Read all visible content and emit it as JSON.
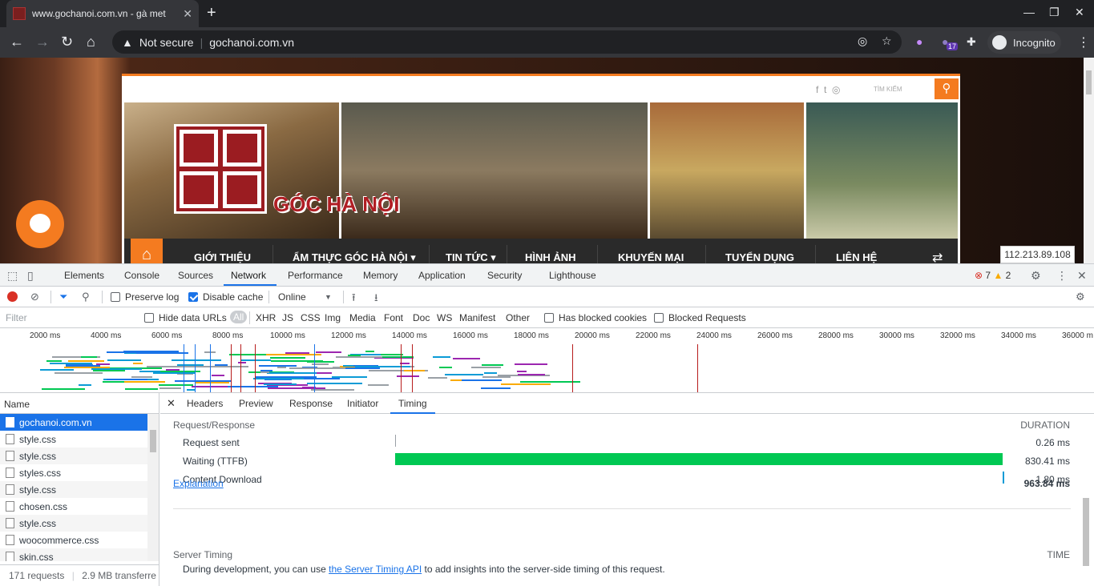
{
  "browser": {
    "tab_title": "www.gochanoi.com.vn - gà met",
    "tab_close": "✕",
    "new_tab": "+",
    "win_min": "—",
    "win_max": "❐",
    "win_close": "✕",
    "security_label": "Not secure",
    "url": "gochanoi.com.vn",
    "incognito_label": "Incognito",
    "extension_badge": "17"
  },
  "site": {
    "search_placeholder": "TÌM KIẾM",
    "logo_text": "GÓC HÀ NỘI",
    "nav_items": [
      "GIỚI THIỆU",
      "ẨM THỰC GÓC HÀ NỘI ▾",
      "TIN TỨC ▾",
      "HÌNH ẢNH",
      "KHUYẾN MẠI",
      "TUYỂN DỤNG",
      "LIÊN HỆ"
    ],
    "ip_tooltip": "112.213.89.108"
  },
  "devtools": {
    "tabs": [
      "Elements",
      "Console",
      "Sources",
      "Network",
      "Performance",
      "Memory",
      "Application",
      "Security",
      "Lighthouse"
    ],
    "active_tab": "Network",
    "error_count": "7",
    "warning_count": "2",
    "preserve_log": "Preserve log",
    "disable_cache": "Disable cache",
    "throttle": "Online",
    "filter_placeholder": "Filter",
    "hide_data_urls": "Hide data URLs",
    "types": [
      "All",
      "XHR",
      "JS",
      "CSS",
      "Img",
      "Media",
      "Font",
      "Doc",
      "WS",
      "Manifest",
      "Other"
    ],
    "has_blocked_cookies": "Has blocked cookies",
    "blocked_requests": "Blocked Requests",
    "overview_ticks": [
      "2000 ms",
      "4000 ms",
      "6000 ms",
      "8000 ms",
      "10000 ms",
      "12000 ms",
      "14000 ms",
      "16000 ms",
      "18000 ms",
      "20000 ms",
      "22000 ms",
      "24000 ms",
      "26000 ms",
      "28000 ms",
      "30000 ms",
      "32000 ms",
      "34000 ms",
      "36000 m"
    ],
    "name_header": "Name",
    "requests": [
      "gochanoi.com.vn",
      "style.css",
      "style.css",
      "styles.css",
      "style.css",
      "chosen.css",
      "style.css",
      "woocommerce.css",
      "skin.css"
    ],
    "status_requests": "171 requests",
    "status_transferred": "2.9 MB transferre",
    "detail_tabs": [
      "Headers",
      "Preview",
      "Response",
      "Initiator",
      "Timing"
    ],
    "active_detail_tab": "Timing",
    "timing": {
      "section": "Request/Response",
      "duration_header": "DURATION",
      "rows": [
        {
          "label": "Request sent",
          "value": "0.26 ms",
          "ms": 0.26,
          "color": "#9aa0a6"
        },
        {
          "label": "Waiting (TTFB)",
          "value": "830.41 ms",
          "ms": 830.41,
          "color": "#00c853"
        },
        {
          "label": "Content Download",
          "value": "1.80 ms",
          "ms": 1.8,
          "color": "#0b9bd6"
        }
      ],
      "explanation": "Explanation",
      "total": "963.84 ms",
      "server_timing": "Server Timing",
      "time_header": "TIME",
      "st_prefix": "During development, you can use ",
      "st_link": "the Server Timing API",
      "st_suffix": " to add insights into the server-side timing of this request."
    }
  }
}
